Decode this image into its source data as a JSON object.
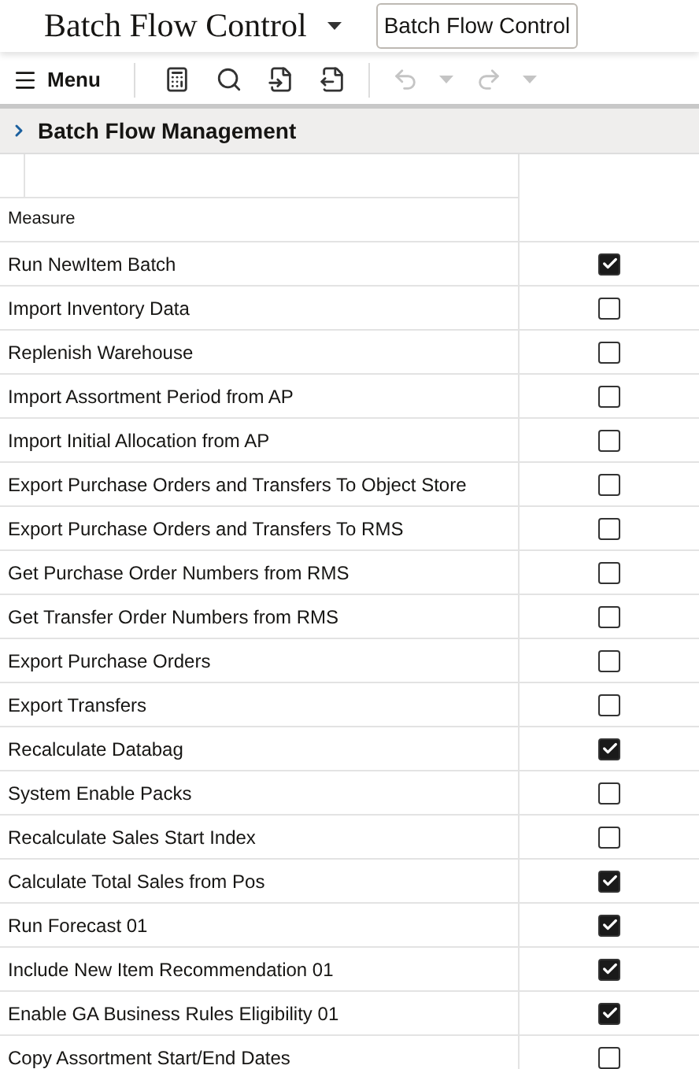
{
  "header": {
    "title": "Batch Flow Control",
    "tab": "Batch Flow Control"
  },
  "toolbar": {
    "menu": "Menu",
    "buttons": [
      {
        "kind": "calculator",
        "disabled": false
      },
      {
        "kind": "search",
        "disabled": false
      },
      {
        "kind": "import",
        "disabled": false
      },
      {
        "kind": "export",
        "disabled": false
      },
      {
        "kind": "undo",
        "disabled": true
      },
      {
        "kind": "dropdown",
        "disabled": true
      },
      {
        "kind": "redo",
        "disabled": true
      },
      {
        "kind": "dropdown",
        "disabled": true
      }
    ]
  },
  "section": {
    "title": "Batch Flow Management",
    "expanded": false
  },
  "table": {
    "header": "Measure",
    "rows": [
      {
        "label": "Run NewItem Batch",
        "checked": true
      },
      {
        "label": "Import Inventory Data",
        "checked": false
      },
      {
        "label": "Replenish Warehouse",
        "checked": false
      },
      {
        "label": "Import Assortment Period from AP",
        "checked": false
      },
      {
        "label": "Import Initial Allocation from AP",
        "checked": false
      },
      {
        "label": "Export Purchase Orders and Transfers To Object Store",
        "checked": false
      },
      {
        "label": "Export Purchase Orders and Transfers To RMS",
        "checked": false
      },
      {
        "label": "Get Purchase Order Numbers from RMS",
        "checked": false
      },
      {
        "label": "Get Transfer Order Numbers from RMS",
        "checked": false
      },
      {
        "label": "Export Purchase Orders",
        "checked": false
      },
      {
        "label": "Export Transfers",
        "checked": false
      },
      {
        "label": "Recalculate Databag",
        "checked": true
      },
      {
        "label": "System Enable Packs",
        "checked": false
      },
      {
        "label": "Recalculate Sales Start Index",
        "checked": false
      },
      {
        "label": "Calculate Total Sales from Pos",
        "checked": true
      },
      {
        "label": "Run Forecast 01",
        "checked": true
      },
      {
        "label": "Include New Item Recommendation 01",
        "checked": true
      },
      {
        "label": "Enable GA Business Rules Eligibility 01",
        "checked": true
      },
      {
        "label": "Copy Assortment Start/End Dates",
        "checked": false
      }
    ]
  }
}
